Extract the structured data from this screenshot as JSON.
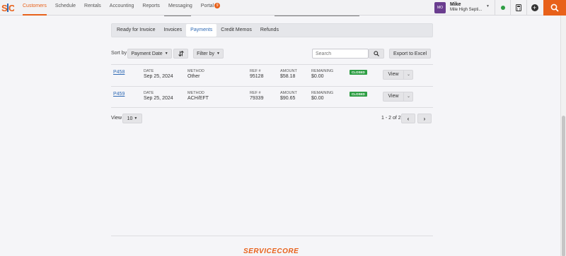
{
  "nav": {
    "logo": "S|C",
    "items": [
      "Customers",
      "Schedule",
      "Rentals",
      "Accounting",
      "Reports",
      "Messaging",
      "Portal"
    ],
    "portal_badge": "9"
  },
  "user": {
    "initials": "MO",
    "name": "Mike",
    "company": "Mile High Septi..."
  },
  "tabs": [
    "Ready for Invoice",
    "Invoices",
    "Payments",
    "Credit Memos",
    "Refunds"
  ],
  "active_tab": "Payments",
  "toolbar": {
    "sort_label": "Sort by",
    "sort_value": "Payment Date",
    "filter_label": "Filter by",
    "search_placeholder": "Search",
    "export_label": "Export to Excel"
  },
  "labels": {
    "date": "DATE",
    "method": "METHOD",
    "ref": "REF #",
    "amount": "AMOUNT",
    "remaining": "REMAINING"
  },
  "payments": [
    {
      "id": "P458",
      "date": "Sep 25, 2024",
      "method": "Other",
      "ref": "95128",
      "amount": "$58.18",
      "remaining": "$0.00",
      "status": "CLOSED",
      "action": "View"
    },
    {
      "id": "P459",
      "date": "Sep 25, 2024",
      "method": "ACH/EFT",
      "ref": "79339",
      "amount": "$90.65",
      "remaining": "$0.00",
      "status": "CLOSED",
      "action": "View"
    }
  ],
  "pager": {
    "view_label": "View",
    "page_size": "10",
    "range": "1 - 2 of 2"
  },
  "footer": {
    "brand": "SERVICECORE"
  },
  "colors": {
    "accent": "#e8611a",
    "link": "#2f6ab5",
    "success": "#2e9e44",
    "avatar": "#6a3d8f"
  }
}
